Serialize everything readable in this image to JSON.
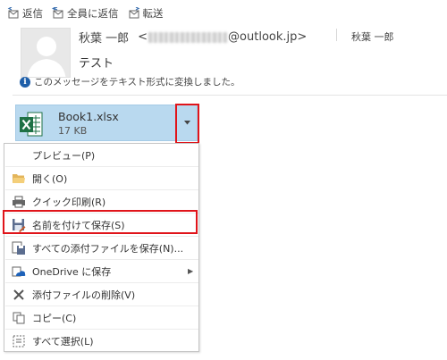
{
  "toolbar": {
    "reply": "返信",
    "reply_all": "全員に返信",
    "forward": "転送"
  },
  "header": {
    "sender_name": "秋葉 一郎",
    "email_prefix": "<",
    "email_domain": "@outlook.jp>",
    "recipient": "秋葉 一郎",
    "subject": "テスト",
    "info_text": "このメッセージをテキスト形式に変換しました。"
  },
  "attachment": {
    "name": "Book1.xlsx",
    "size": "17 KB"
  },
  "menu": {
    "items": [
      {
        "label": "プレビュー(P)",
        "icon": "none"
      },
      {
        "label": "開く(O)",
        "icon": "folder-icon"
      },
      {
        "label": "クイック印刷(R)",
        "icon": "printer-icon"
      },
      {
        "label": "名前を付けて保存(S)",
        "icon": "save-as-icon"
      },
      {
        "label": "すべての添付ファイルを保存(N)...",
        "icon": "save-all-icon"
      },
      {
        "label": "OneDrive に保存",
        "icon": "onedrive-icon"
      },
      {
        "label": "添付ファイルの削除(V)",
        "icon": "delete-x-icon"
      },
      {
        "label": "コピー(C)",
        "icon": "copy-icon"
      },
      {
        "label": "すべて選択(L)",
        "icon": "select-all-icon"
      }
    ]
  },
  "colors": {
    "highlight_red": "#e0141a",
    "attachment_bg": "#b9d9ef",
    "excel_green": "#1e7145"
  }
}
